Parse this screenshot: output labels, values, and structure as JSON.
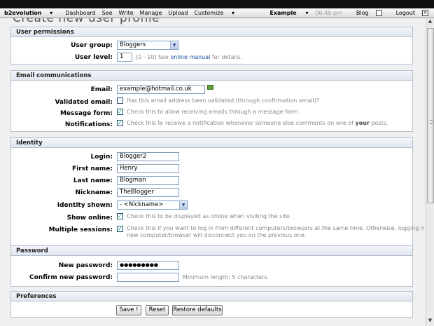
{
  "evobar": {
    "brand": "b2evolution",
    "brand_arrow": "▾",
    "menu": [
      "Dashboard",
      "See",
      "Write",
      "Manage",
      "Upload",
      "Customize"
    ],
    "customize_arrow": "▾",
    "site": "Example",
    "site_arrow": "▾",
    "time": "06:40 pm",
    "blog": "Blog",
    "logout": "Logout"
  },
  "page": {
    "title": "Create new user profile"
  },
  "sections": {
    "permissions": {
      "title": "User permissions",
      "group_label": "User group:",
      "group_value": "Bloggers",
      "level_label": "User level:",
      "level_value": "1",
      "level_note_pre": "[0 - 10] See",
      "level_note_link": "online manual",
      "level_note_post": "for details."
    },
    "email": {
      "title": "Email communications",
      "email_label": "Email:",
      "email_value": "example@hotmail.co.uk",
      "validated_label": "Validated email:",
      "validated_note": "Has this email address been validated (through confirmation email)?",
      "validated_checked": false,
      "msgform_label": "Message form:",
      "msgform_note": "Check this to allow receiving emails through a message form.",
      "msgform_checked": true,
      "notif_label": "Notifications:",
      "notif_note_pre": "Check this to receive a notification whenever someone else comments on one of",
      "notif_note_bold": "your",
      "notif_note_post": "posts.",
      "notif_checked": true
    },
    "identity": {
      "title": "Identity",
      "login_label": "Login:",
      "login_value": "Blogger2",
      "first_label": "First name:",
      "first_value": "Henry",
      "last_label": "Last name:",
      "last_value": "Blogman",
      "nick_label": "Nickname:",
      "nick_value": "TheBlogger",
      "shown_label": "Identity shown:",
      "shown_value": "- <Nickname>",
      "online_label": "Show online:",
      "online_note": "Check this to be displayed as online when visiting the site.",
      "multi_label": "Multiple sessions:",
      "multi_note_1": "Check this if you want to log in from different computers/browsers at the same time. Otherwise, logging in from a",
      "multi_note_2": "new computer/browser will disconnect you on the previous one."
    },
    "password": {
      "title": "Password",
      "new_label": "New password:",
      "new_value": "●●●●●●●●●",
      "confirm_label": "Confirm new password:",
      "confirm_note": "Minimum length: 5 characters."
    },
    "preferences": {
      "title": "Preferences"
    }
  },
  "buttons": {
    "save": "Save !",
    "reset": "Reset",
    "restore": "Restore defaults"
  },
  "icons": {
    "check": "✓",
    "select_arrow": "▼",
    "scroll_up": "▲",
    "scroll_down": "▼"
  },
  "colors": {
    "accent": "#1d4fa0",
    "legend_border": "#b4c0cf",
    "checkmark": "#2a9a2a"
  }
}
